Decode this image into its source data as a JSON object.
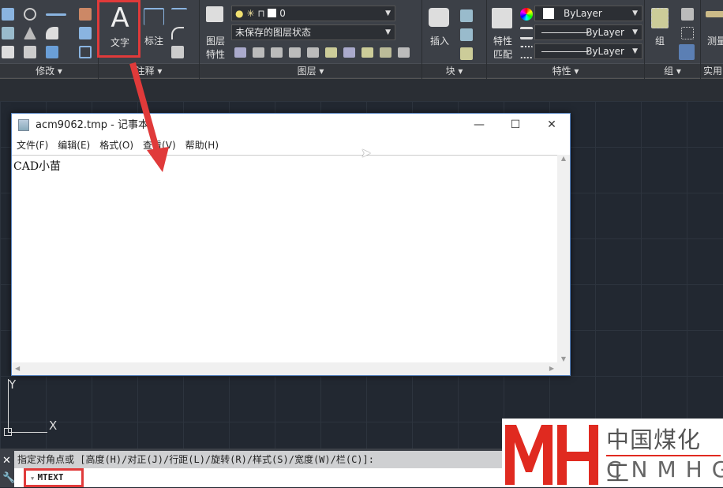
{
  "ribbon": {
    "panels": {
      "modify": "修改 ▾",
      "annotation": "注释 ▾",
      "layers": "图层 ▾",
      "block": "块 ▾",
      "properties": "特性 ▾",
      "group": "组 ▾",
      "utilities": "实用"
    },
    "text_button": "文字",
    "dimension_button": "标注",
    "layer_properties_button": [
      "图层",
      "特性"
    ],
    "layer_combo": "0",
    "layer_state_combo": "未保存的图层状态",
    "insert_button": "插入",
    "match_properties_button": [
      "特性",
      "匹配"
    ],
    "color_combo": "ByLayer",
    "linetype_combo": "ByLayer",
    "lineweight_combo": "ByLayer",
    "group_button": "组",
    "measure_button": "测量"
  },
  "notepad": {
    "title": "acm9062.tmp - 记事本",
    "menu": [
      "文件(F)",
      "编辑(E)",
      "格式(O)",
      "查看(V)",
      "帮助(H)"
    ],
    "content": "CAD小苗"
  },
  "ucs": {
    "x": "X",
    "y": "Y"
  },
  "command": {
    "history": "指定对角点或 [高度(H)/对正(J)/行距(L)/旋转(R)/样式(S)/宽度(W)/栏(C)]:",
    "current": "MTEXT"
  },
  "watermark": {
    "cn": "中国煤化工",
    "en": "CNMHG"
  },
  "colors": {
    "highlight": "#e03a3a",
    "ribbon": "#3c4047",
    "canvas": "#222831"
  }
}
